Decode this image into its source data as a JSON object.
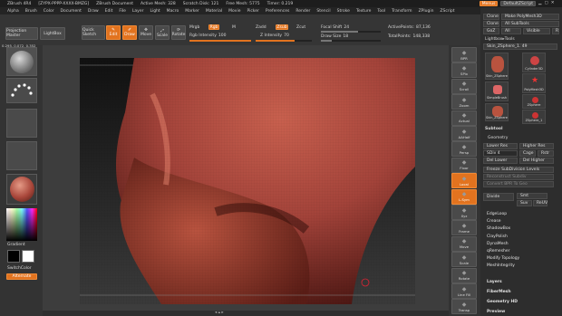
{
  "title_bar": {
    "app": "ZBrush 4R4",
    "build": "[ZYPX-PPPP-XXXX-BMZG]",
    "document": "ZBrush Document",
    "active_mesh": "Active Mesh: 328",
    "scratch_disk": "Scratch Disk: 121",
    "free_mesh": "Free Mesh: 5775",
    "timer": "Timer: 0.219",
    "menus_btn": "Menus",
    "script_btn": "DefaultZScript"
  },
  "menu_bar": [
    "Alpha",
    "Brush",
    "Color",
    "Document",
    "Draw",
    "Edit",
    "File",
    "Layer",
    "Light",
    "Macro",
    "Marker",
    "Material",
    "Movie",
    "Picker",
    "Preferences",
    "Render",
    "Stencil",
    "Stroke",
    "Texture",
    "Tool",
    "Transform",
    "ZPlugin",
    "ZScript"
  ],
  "top_toolbar": {
    "projection_master": "Projection Master",
    "lightbox": "LightBox",
    "quick_sketch": "Quick Sketch",
    "edit": "Edit",
    "draw": "Draw",
    "move": "Move",
    "scale": "Scale",
    "rotate": "Rotate",
    "mrgb": "Mrgb",
    "rgb": "Rgb",
    "m": "M",
    "rgb_intensity_label": "Rgb Intensity",
    "rgb_intensity": "100",
    "zadd": "Zadd",
    "zsub": "Zsub",
    "zcut": "Zcut",
    "z_intensity_label": "Z Intensity",
    "z_intensity": "70",
    "focal_shift_label": "Focal Shift",
    "focal_shift": "24",
    "draw_size_label": "Draw Size",
    "draw_size": "18",
    "active_points_label": "ActivePoints:",
    "active_points": "87,136",
    "total_points_label": "TotalPoints:",
    "total_points": "148,338"
  },
  "left_shelf": {
    "coords": "0.295, 0.072, 0.352",
    "gradient": "Gradient",
    "switch_color": "SwitchColor",
    "alternate": "Alternate"
  },
  "right_shelf": [
    "BPR",
    "SPix",
    "Scroll",
    "Zoom",
    "Actual",
    "AAHalf",
    "Persp",
    "Floor",
    "Local",
    "L.Sym",
    "Xyz",
    "Frame",
    "Move",
    "Scale",
    "Rotate",
    "Line Fill",
    "Transp"
  ],
  "tray": {
    "top_buttons": [
      [
        "Clone",
        "Make PolyMesh3D"
      ],
      [
        "Clone",
        "All SubTools"
      ],
      [
        "GoZ",
        "All",
        "Visible",
        "R"
      ]
    ],
    "lightbox_tools": "Lightbox▸Tools",
    "current_tool": "Skin_ZSphere_1. 49",
    "tools": [
      "Skin_ZSphere",
      "Cylinder3D",
      "PolyMesh3D",
      "SimpleBrush",
      "ZSphere",
      "Skin_ZSphere",
      "ZSphere_1"
    ],
    "subtool": "Subtool",
    "geometry": "Geometry",
    "lower_res": "Lower Res",
    "higher_res": "Higher Res",
    "sdiv": "SDiv",
    "sdiv_value": "4",
    "cage": "Cage",
    "rstr": "Rstr",
    "del_lower": "Del Lower",
    "del_higher": "Del Higher",
    "freeze_sub": "Freeze SubDivision Levels",
    "reconstruct": "Reconstruct Subdiv",
    "convert_bpr": "Convert BPR To Geo",
    "divide": "Divide",
    "smt": "Smt",
    "suv": "Suv",
    "rsmt": "ReUV",
    "sections": [
      "EdgeLoop",
      "Crease",
      "ShadowBox",
      "ClayPolish",
      "DynaMesh",
      "qRemesher",
      "Modify Topology",
      "MeshIntegrity"
    ],
    "bottom_sections": [
      "Layers",
      "FiberMesh",
      "Geometry HD",
      "Preview"
    ]
  },
  "colors": {
    "accent": "#e2731f",
    "skin": "#a8463a",
    "background": "#2b2b2b"
  }
}
